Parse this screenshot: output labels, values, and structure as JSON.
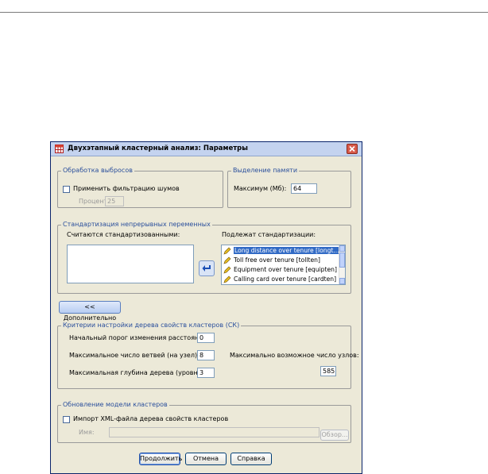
{
  "dialog": {
    "title": "Двухэтапный кластерный анализ: Параметры",
    "outliers": {
      "legend": "Обработка выбросов",
      "noise_check": "Применить фильтрацию шумов",
      "percent_label": "Процент:",
      "percent_value": "25"
    },
    "memory": {
      "legend": "Выделение памяти",
      "max_label": "Максимум (Мб):",
      "max_value": "64"
    },
    "standardization": {
      "legend": "Стандартизация непрерывных переменных",
      "left_label": "Считаются стандартизованными:",
      "right_label": "Подлежат стандартизации:",
      "items": [
        {
          "text": "Long distance over tenure [longt...",
          "selected": true
        },
        {
          "text": "Toll free over tenure [tollten]",
          "selected": false
        },
        {
          "text": "Equipment over tenure [equipten]",
          "selected": false
        },
        {
          "text": "Calling card over tenure [cardten]",
          "selected": false
        }
      ]
    },
    "advanced_button": "<< Дополнительно",
    "cf_tree": {
      "legend": "Критерии настройки дерева свойств кластеров (СК)",
      "threshold_label": "Начальный порог изменения расстояния:",
      "threshold_value": "0",
      "branches_label": "Максимальное число ветвей (на узел):",
      "branches_value": "8",
      "depth_label": "Максимальная глубина дерева (уровней):",
      "depth_value": "3",
      "max_nodes_label": "Максимально возможное число узлов:",
      "max_nodes_value": "585"
    },
    "model_update": {
      "legend": "Обновление модели кластеров",
      "import_check": "Импорт XML-файла дерева свойств кластеров",
      "name_label": "Имя:",
      "name_value": "",
      "browse_button": "Обзор..."
    },
    "buttons": {
      "continue": "Продолжить",
      "cancel": "Отмена",
      "help": "Справка"
    }
  }
}
